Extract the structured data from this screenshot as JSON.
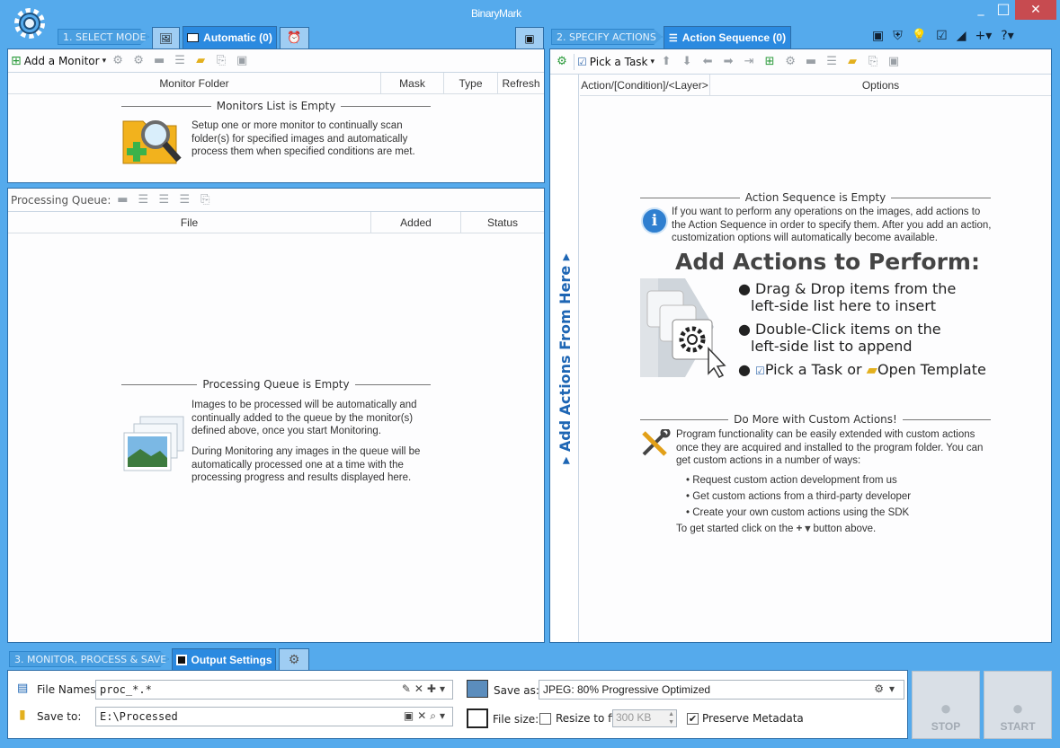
{
  "app": {
    "logo_text": "BinaryMark",
    "win_controls": [
      "_",
      "□",
      "✕"
    ]
  },
  "steps": {
    "select_mode": "1. SELECT MODE",
    "specify_actions": "2. SPECIFY ACTIONS",
    "monitor": "3. MONITOR, PROCESS & SAVE"
  },
  "tabs": {
    "automatic": "Automatic (0)",
    "action_sequence": "Action Sequence (0)",
    "output_settings": "Output Settings"
  },
  "monitors": {
    "add_label": "Add a Monitor",
    "columns": [
      "Monitor Folder",
      "Mask",
      "Type",
      "Refresh"
    ],
    "empty_title": "Monitors List is Empty",
    "empty_desc": "Setup one or more monitor to continually scan folder(s) for specified images and automatically process them when specified conditions are met."
  },
  "queue": {
    "label": "Processing Queue:",
    "columns": [
      "File",
      "Added",
      "Status"
    ],
    "empty_title": "Processing Queue is Empty",
    "desc1": "Images to be processed will be automatically and continually added to the queue by the monitor(s) defined above, once you start Monitoring.",
    "desc2": "During Monitoring any images in the queue will be automatically processed one at a time with the processing progress and results displayed here."
  },
  "actions": {
    "pick_task": "Pick a Task",
    "columns": [
      "Action/[Condition]/<Layer>",
      "Options"
    ],
    "side_label": "Add Actions From Here",
    "empty_title": "Action Sequence is Empty",
    "empty_desc": "If you want to perform any operations on the images, add actions to the Action Sequence in order to specify them. After you add an action, customization options will automatically become available.",
    "big_title": "Add Actions to Perform:",
    "b1a": "Drag & Drop items from the",
    "b1b": "left-side list here to insert",
    "b2a": "Double-Click items on the",
    "b2b": "left-side list to append",
    "b3_pick": "Pick a Task or",
    "b3_open": "Open Template",
    "custom_title": "Do More with Custom Actions!",
    "custom_desc": "Program functionality can be easily extended with custom actions once they are acquired and installed to the program folder. You can get custom actions in a number of ways:",
    "custom_items": [
      "Request custom action development from us",
      "Get custom actions from a third-party developer",
      "Create your own custom actions using the SDK"
    ],
    "get_started_pre": "To get started click on the",
    "get_started_post": "button above."
  },
  "output": {
    "file_names_label": "File Names:",
    "file_names_value": "proc_*.*",
    "save_to_label": "Save to:",
    "save_to_value": "E:\\Processed",
    "save_as_label": "Save as:",
    "save_as_value": "JPEG: 80%  Progressive Optimized",
    "file_size_label": "File size:",
    "resize_label": "Resize to fit:",
    "resize_value": "300 KB",
    "preserve_label": "Preserve Metadata",
    "resize_checked": "",
    "preserve_checked": "✔"
  },
  "buttons": {
    "stop": "STOP",
    "start": "START"
  }
}
